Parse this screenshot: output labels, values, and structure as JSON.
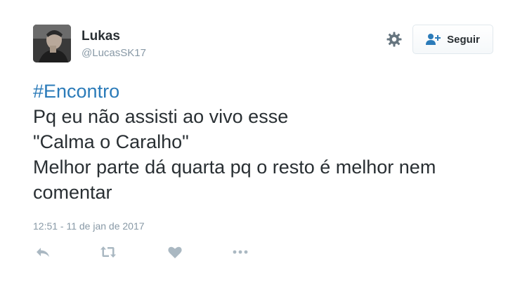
{
  "tweet": {
    "user": {
      "name": "Lukas",
      "handle": "@LucasSK17"
    },
    "follow_button": {
      "label": "Seguir",
      "icon": "add-user-icon"
    },
    "settings_icon": "gear-icon",
    "hashtag": "#Encontro",
    "lines": [
      "Pq eu não assisti ao vivo esse",
      "\"Calma o Caralho\"",
      "Melhor parte dá quarta pq o resto é melhor nem",
      "comentar"
    ],
    "timestamp": "12:51 - 11 de jan de 2017",
    "actions": [
      "reply-icon",
      "retweet-icon",
      "like-icon",
      "more-icon"
    ]
  },
  "colors": {
    "link": "#2b7bb9",
    "text": "#292f33",
    "muted": "#8899a6",
    "icon": "#aab8c2"
  }
}
